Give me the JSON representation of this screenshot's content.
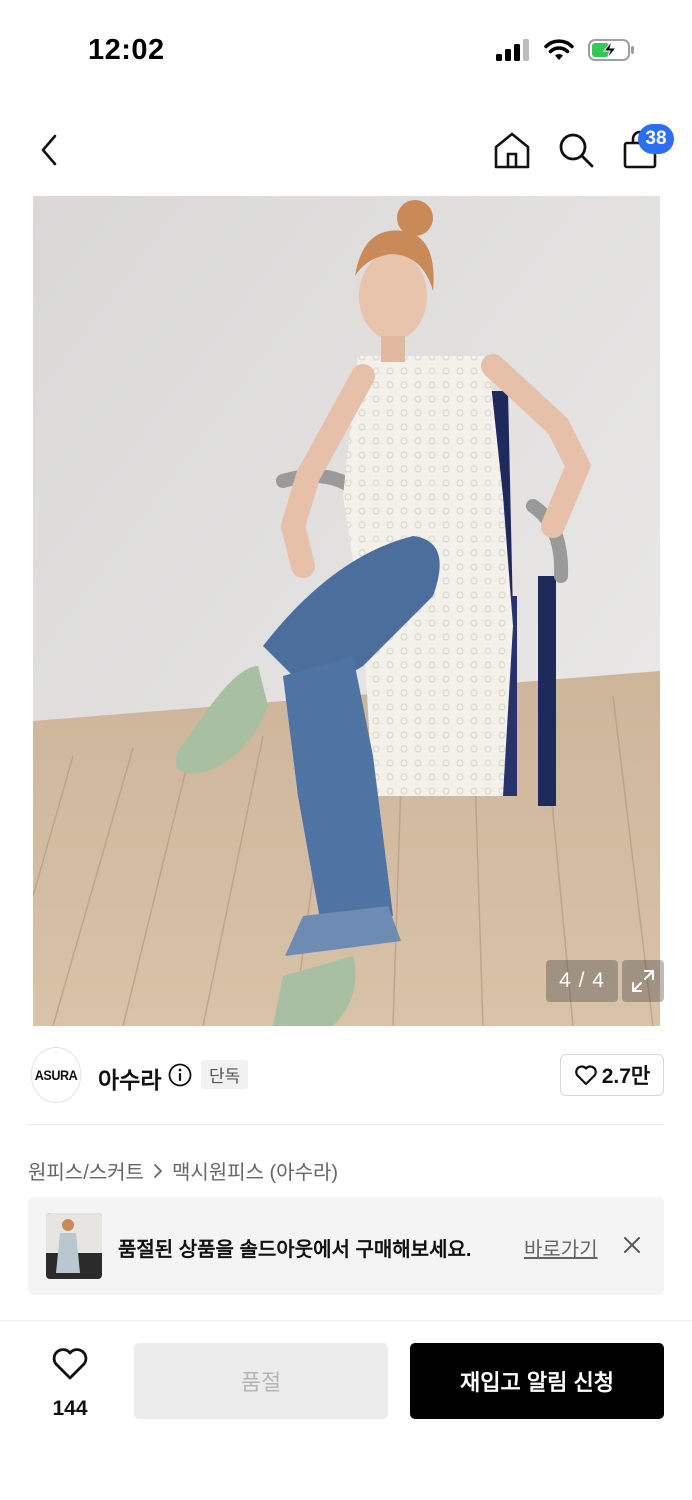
{
  "status_bar": {
    "time": "12:02"
  },
  "nav": {
    "cart_count": "38"
  },
  "gallery": {
    "counter": "4 / 4"
  },
  "brand": {
    "logo_text": "ASURA",
    "name": "아수라",
    "badge": "단독",
    "likes": "2.7만"
  },
  "breadcrumb": {
    "category": "원피스/스커트",
    "subcategory": "맥시원피스 (아수라)"
  },
  "banner": {
    "message": "품절된 상품을 솔드아웃에서 구매해보세요.",
    "link_label": "바로가기"
  },
  "bottom_bar": {
    "wish_count": "144",
    "soldout_label": "품절",
    "restock_label": "재입고 알림 신청"
  },
  "colors": {
    "accent_badge": "#2c6ff5",
    "primary_button": "#000000",
    "disabled_button": "#ececec"
  }
}
